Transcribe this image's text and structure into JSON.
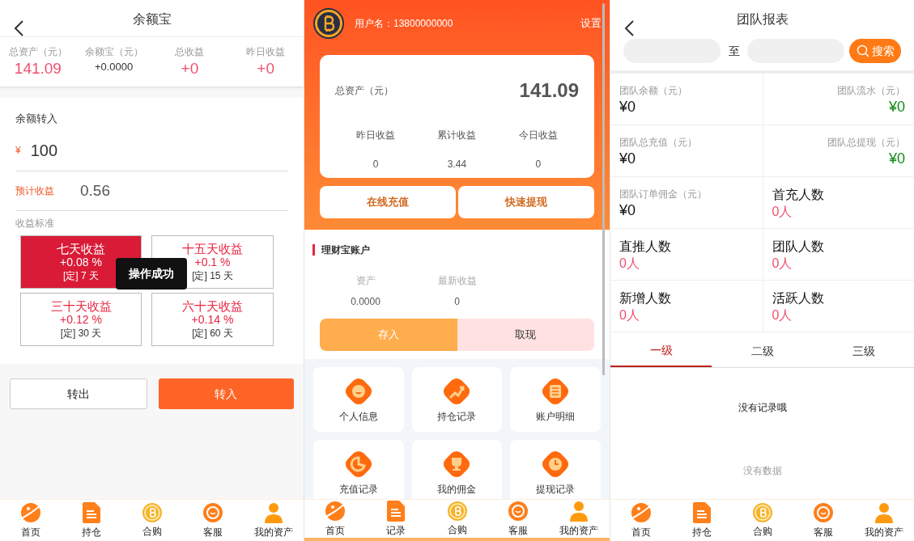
{
  "balance_screen": {
    "title": "余额宝",
    "stats": [
      {
        "label": "总资产（元）",
        "value": "141.09",
        "highlight": true
      },
      {
        "label": "余额宝（元）",
        "value": "+0.0000",
        "highlight": false
      },
      {
        "label": "总收益",
        "value": "+0",
        "highlight": true
      },
      {
        "label": "昨日收益",
        "value": "+0",
        "highlight": true
      }
    ],
    "transfer": {
      "heading": "余额转入",
      "currency": "¥",
      "amount": "100",
      "estimate_label": "预计收益",
      "estimate_value": "0.56",
      "standard_label": "收益标准"
    },
    "plans": [
      {
        "title": "七天收益",
        "rate": "+0.08 %",
        "term": "[定] 7 天",
        "selected": true
      },
      {
        "title": "十五天收益",
        "rate": "+0.1 %",
        "term": "[定] 15 天",
        "selected": false
      },
      {
        "title": "三十天收益",
        "rate": "+0.12 %",
        "term": "[定] 30 天",
        "selected": false
      },
      {
        "title": "六十天收益",
        "rate": "+0.14 %",
        "term": "[定] 60 天",
        "selected": false
      }
    ],
    "toast": "操作成功",
    "buttons": [
      {
        "label": "转出",
        "kind": "outline"
      },
      {
        "label": "转入",
        "kind": "primary"
      }
    ],
    "nav": [
      "首页",
      "持仓",
      "合购",
      "客服",
      "我的资产"
    ]
  },
  "account_screen": {
    "username": "用户名：13800000000",
    "settings": "设置",
    "total_label": "总资产（元）",
    "total_value": "141.09",
    "earnings": [
      {
        "label": "昨日收益",
        "value": "0"
      },
      {
        "label": "累计收益",
        "value": "3.44"
      },
      {
        "label": "今日收益",
        "value": "0"
      }
    ],
    "actions": [
      "在线充值",
      "快速提现"
    ],
    "wealth": {
      "title": "理财宝账户",
      "stats": [
        {
          "label": "资产",
          "value": "0.0000"
        },
        {
          "label": "最新收益",
          "value": "0"
        }
      ],
      "buttons": [
        {
          "label": "存入",
          "kind": "primary"
        },
        {
          "label": "取现",
          "kind": "secondary"
        }
      ]
    },
    "menu": [
      "个人信息",
      "持仓记录",
      "账户明细",
      "充值记录",
      "我的佣金",
      "提现记录"
    ],
    "nav": [
      "首页",
      "记录",
      "合购",
      "客服",
      "我的资产"
    ]
  },
  "team_screen": {
    "title": "团队报表",
    "range_separator": "至",
    "search_button": "搜索",
    "cells": [
      {
        "kind": "amount",
        "label": "团队余额（元）",
        "value": "¥0",
        "color": "#111111"
      },
      {
        "kind": "amount",
        "label": "团队流水（元）",
        "value": "¥0",
        "color": "#138a13"
      },
      {
        "kind": "amount",
        "label": "团队总充值（元）",
        "value": "¥0",
        "color": "#111111"
      },
      {
        "kind": "amount",
        "label": "团队总提现（元）",
        "value": "¥0",
        "color": "#138a13"
      },
      {
        "kind": "amount",
        "label": "团队订单佣金（元）",
        "value": "¥0",
        "color": "#111111"
      },
      {
        "kind": "count",
        "label": "首充人数",
        "value": "0人"
      },
      {
        "kind": "count",
        "label": "直推人数",
        "value": "0人"
      },
      {
        "kind": "count",
        "label": "团队人数",
        "value": "0人"
      },
      {
        "kind": "count",
        "label": "新增人数",
        "value": "0人"
      },
      {
        "kind": "count",
        "label": "活跃人数",
        "value": "0人"
      }
    ],
    "tabs": [
      {
        "label": "一级",
        "selected": true
      },
      {
        "label": "二级",
        "selected": false
      },
      {
        "label": "三级",
        "selected": false
      }
    ],
    "empty_message": "没有记录哦",
    "no_data": "没有数据",
    "nav": [
      "首页",
      "持仓",
      "合购",
      "客服",
      "我的资产"
    ]
  }
}
